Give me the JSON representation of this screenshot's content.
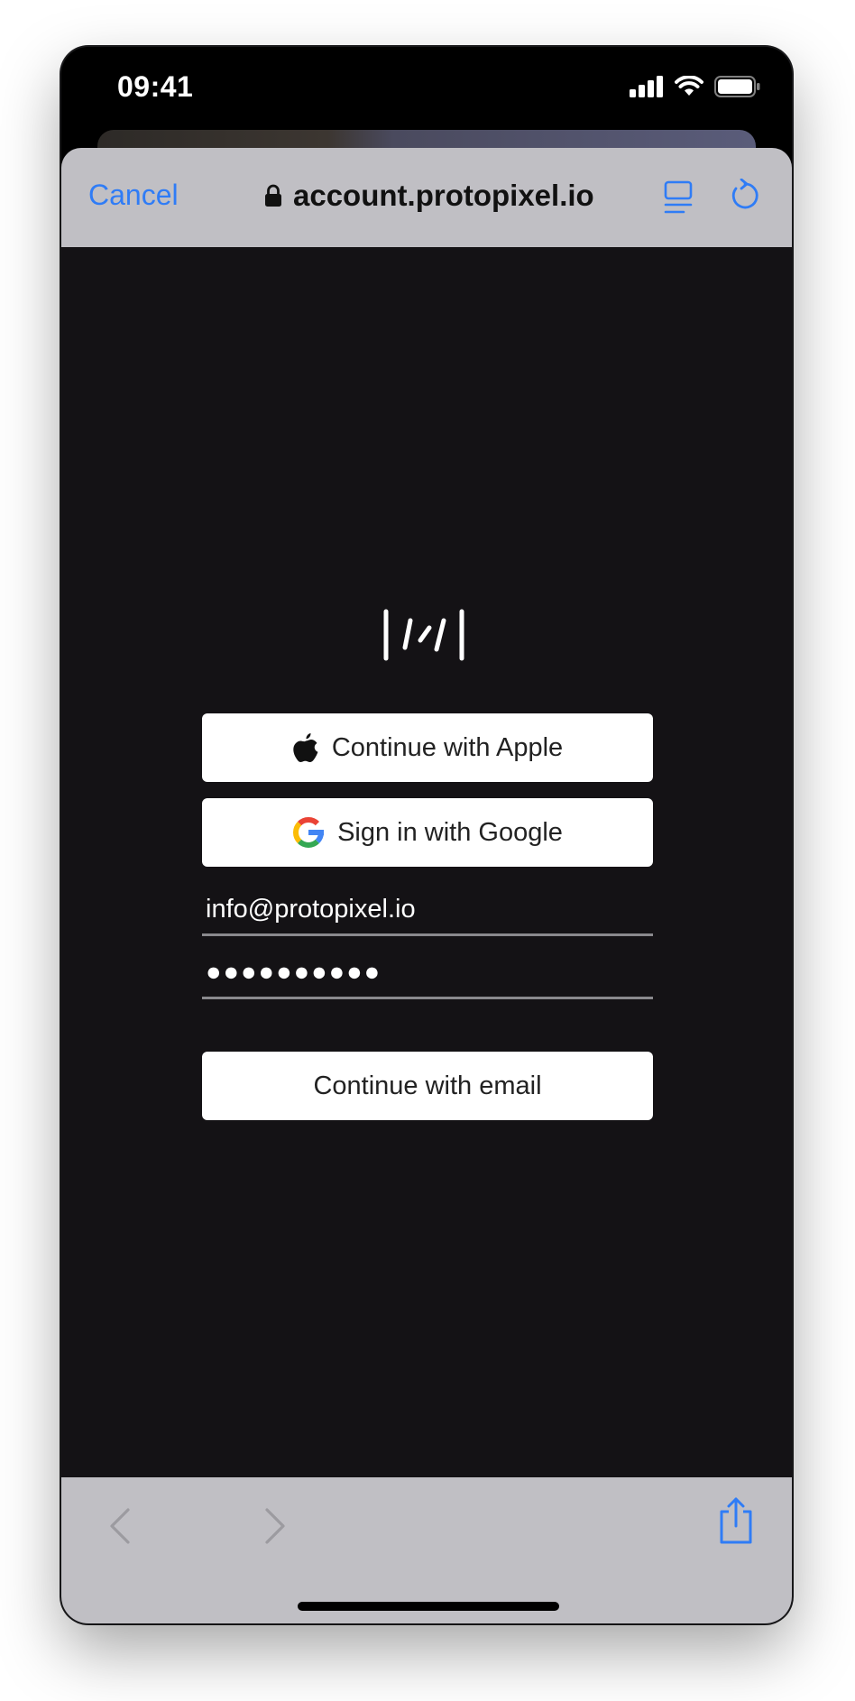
{
  "status_bar": {
    "time": "09:41"
  },
  "browser": {
    "cancel_label": "Cancel",
    "url": "account.protopixel.io"
  },
  "login": {
    "apple_label": "Continue with Apple",
    "google_label": "Sign in with Google",
    "email_value": "info@protopixel.io",
    "password_value": "●●●●●●●●●●",
    "email_button_label": "Continue with email"
  },
  "colors": {
    "accent": "#2f7cf6",
    "toolbar_bg": "#c0bfc4",
    "content_bg": "#141215"
  }
}
